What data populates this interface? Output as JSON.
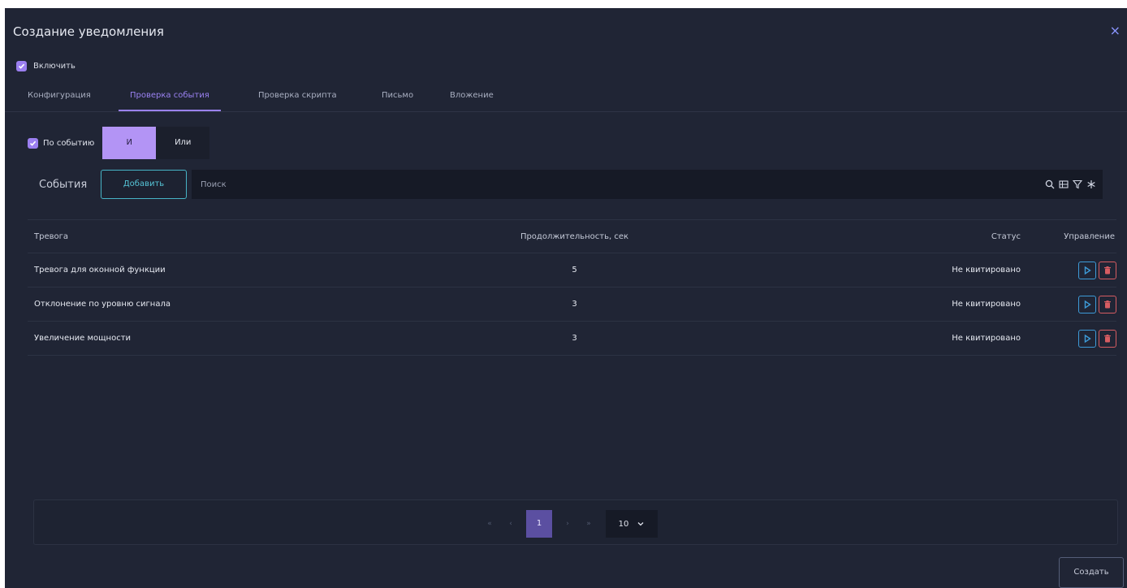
{
  "dialog": {
    "title": "Создание уведомления",
    "close_icon": "×"
  },
  "enable": {
    "label": "Включить",
    "checked": true
  },
  "tabs": [
    {
      "label": "Конфигурация",
      "active": false
    },
    {
      "label": "Проверка события",
      "active": true
    },
    {
      "label": "Проверка скрипта",
      "active": false
    },
    {
      "label": "Письмо",
      "active": false
    },
    {
      "label": "Вложение",
      "active": false
    }
  ],
  "by_event": {
    "label": "По событию",
    "checked": true,
    "and_label": "И",
    "or_label": "Или",
    "selected": "И"
  },
  "events": {
    "label": "События",
    "add_label": "Добавить",
    "search_placeholder": "Поиск"
  },
  "table": {
    "headers": [
      "Тревога",
      "Продолжительность, сек",
      "Статус",
      "Управление"
    ],
    "rows": [
      {
        "alarm": "Тревога для оконной функции",
        "duration": "5",
        "status": "Не квитировано"
      },
      {
        "alarm": "Отклонение по уровню сигнала",
        "duration": "3",
        "status": "Не квитировано"
      },
      {
        "alarm": "Увеличение мощности",
        "duration": "3",
        "status": "Не квитировано"
      }
    ]
  },
  "pagination": {
    "first": "«",
    "prev": "‹",
    "current_page": "1",
    "next": "›",
    "last": "»",
    "page_size": "10"
  },
  "footer": {
    "create_label": "Создать"
  },
  "colors": {
    "background": "#202535",
    "accent": "#9b82f2",
    "add_button": "#47b4c6",
    "play_button": "#3d9bd8",
    "delete_button": "#d65c62"
  }
}
